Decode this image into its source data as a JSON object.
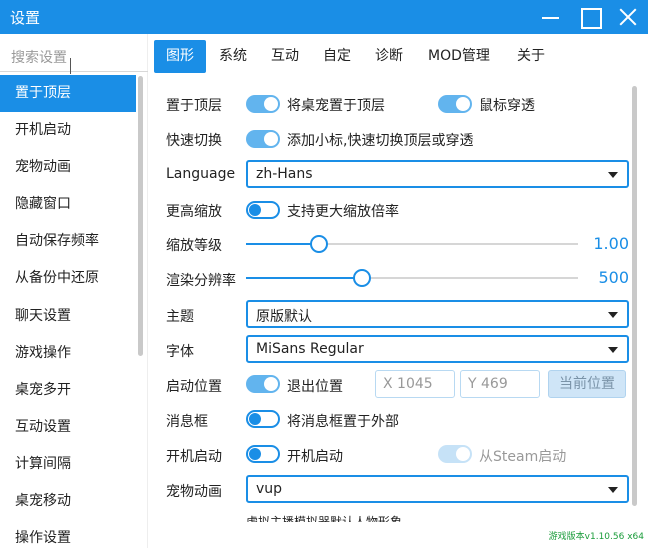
{
  "window": {
    "title": "设置"
  },
  "search": {
    "placeholder": "搜索设置"
  },
  "sidebar": {
    "items": [
      {
        "label": "置于顶层"
      },
      {
        "label": "开机启动"
      },
      {
        "label": "宠物动画"
      },
      {
        "label": "隐藏窗口"
      },
      {
        "label": "自动保存频率"
      },
      {
        "label": "从备份中还原"
      },
      {
        "label": "聊天设置"
      },
      {
        "label": "游戏操作"
      },
      {
        "label": "桌宠多开"
      },
      {
        "label": "互动设置"
      },
      {
        "label": "计算间隔"
      },
      {
        "label": "桌宠移动"
      },
      {
        "label": "操作设置"
      }
    ],
    "active_index": 0
  },
  "tabs": [
    {
      "label": "图形"
    },
    {
      "label": "系统"
    },
    {
      "label": "互动"
    },
    {
      "label": "自定"
    },
    {
      "label": "诊断"
    },
    {
      "label": "MOD管理"
    },
    {
      "label": "关于"
    }
  ],
  "settings": {
    "topmost": {
      "label": "置于顶层",
      "toggle_text": "将桌宠置于顶层",
      "toggle_on": true
    },
    "mouse_through": {
      "toggle_text": "鼠标穿透",
      "toggle_on": true
    },
    "quick_switch": {
      "label": "快速切换",
      "toggle_text": "添加小标,快速切换顶层或穿透",
      "toggle_on": true
    },
    "language": {
      "label": "Language",
      "value": "zh-Hans"
    },
    "larger_zoom": {
      "label": "更高缩放",
      "toggle_text": "支持更大缩放倍率",
      "toggle_on": false
    },
    "zoom_level": {
      "label": "缩放等级",
      "value_text": "1.00",
      "fraction": 0.22
    },
    "render_resolution": {
      "label": "渲染分辨率",
      "value_text": "500",
      "fraction": 0.35
    },
    "theme": {
      "label": "主题",
      "value": "原版默认"
    },
    "font": {
      "label": "字体",
      "value": "MiSans Regular"
    },
    "start_position": {
      "label": "启动位置",
      "toggle_text": "退出位置",
      "toggle_on": true,
      "x_placeholder": "X 1045",
      "y_placeholder": "Y 469",
      "button_label": "当前位置"
    },
    "message_box": {
      "label": "消息框",
      "toggle_text": "将消息框置于外部",
      "toggle_on": false
    },
    "autostart": {
      "label": "开机启动",
      "toggle_text": "开机启动",
      "toggle_on": false
    },
    "steam_start": {
      "toggle_text": "从Steam启动",
      "toggle_on": true,
      "disabled": true
    },
    "pet_animation": {
      "label": "宠物动画",
      "value": "vup"
    },
    "cutoff_text": "虚拟主播模拟器默认人物形象"
  },
  "footer": {
    "version": "游戏版本v1.10.56 x64"
  },
  "colors": {
    "accent": "#1a8ee6",
    "version_text": "#1a9c3a"
  }
}
